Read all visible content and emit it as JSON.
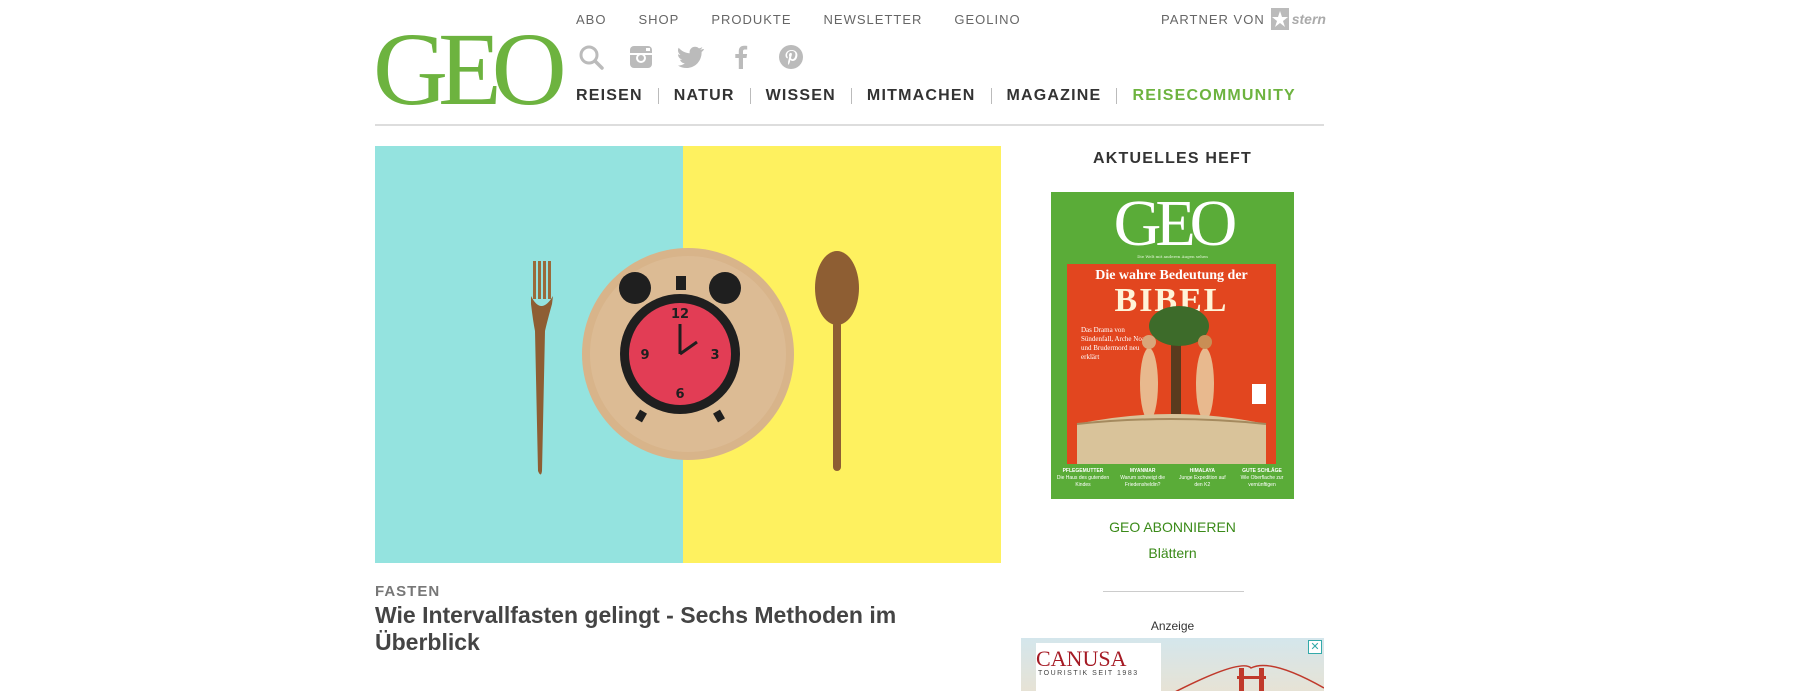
{
  "brand": {
    "logo": "GEO",
    "accent_color": "#6db33f"
  },
  "topnav": {
    "items": [
      "ABO",
      "SHOP",
      "PRODUKTE",
      "NEWSLETTER",
      "GEOLINO"
    ],
    "partner_label": "PARTNER VON",
    "partner_logo": "stern"
  },
  "social_icons": [
    "search-icon",
    "instagram-icon",
    "twitter-icon",
    "facebook-icon",
    "pinterest-icon"
  ],
  "mainnav": {
    "items": [
      "REISEN",
      "NATUR",
      "WISSEN",
      "MITMACHEN",
      "MAGAZINE",
      "REISECOMMUNITY"
    ]
  },
  "hero": {
    "kicker": "FASTEN",
    "headline": "Wie Intervallfasten gelingt - Sechs Methoden im Überblick",
    "image_desc_colors": {
      "left": "#94e3df",
      "right": "#fef15f",
      "clock": "#e23d55"
    }
  },
  "sidebar": {
    "title": "AKTUELLES HEFT",
    "cover": {
      "logo": "GEO",
      "tagline": "Die Welt mit anderen Augen sehen",
      "subtitle": "Die wahre Bedeutung der",
      "big_title": "BIBEL",
      "blurb": "Das Drama von Sündenfall, Arche Noah und Brudermord neu erklärt",
      "footer": [
        {
          "head": "PFLEGEMUTTER",
          "text": "Die Haus des gutenden Kindes"
        },
        {
          "head": "MYANMAR",
          "text": "Warum schweigt die Friedensheldin?"
        },
        {
          "head": "HIMALAYA",
          "text": "Junge Expedition auf den K2"
        },
        {
          "head": "GUTE SCHLÄGE",
          "text": "Wie Oberflache zur vernünftigen"
        }
      ]
    },
    "subscribe_link": "GEO ABONNIEREN",
    "browse_link": "Blättern",
    "ad_label": "Anzeige",
    "ad": {
      "logo": "CANUSA",
      "logo_sub": "TOURISTIK SEIT 1983",
      "close": "✕"
    }
  }
}
